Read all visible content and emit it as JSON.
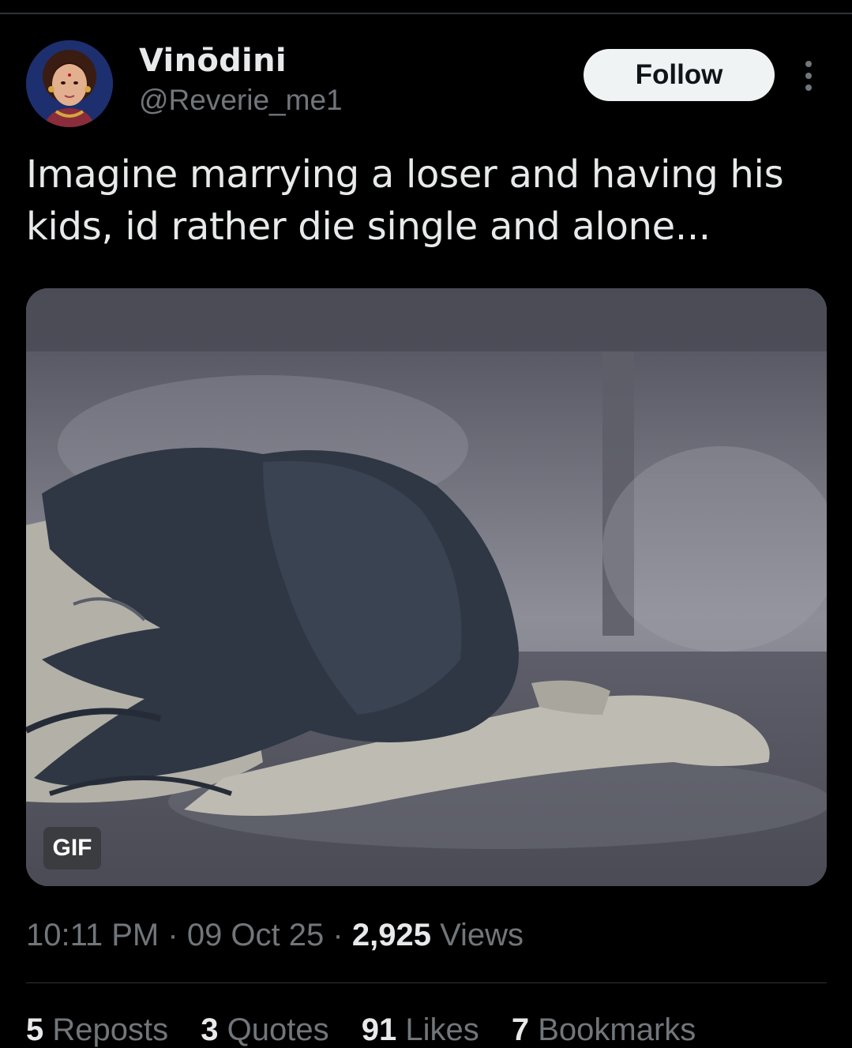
{
  "author": {
    "display_name": "Vinōdini",
    "handle": "@Reverie_me1",
    "avatar_icon": "profile-portrait-icon"
  },
  "actions": {
    "follow_label": "Follow",
    "more_icon": "more-vertical-icon"
  },
  "tweet": {
    "text_line1": "Imagine marrying a loser and having his",
    "text_line2": "kids, id rather die single and alone..."
  },
  "media": {
    "badge": "GIF"
  },
  "meta": {
    "time": "10:11 PM",
    "date": "09 Oct 25",
    "separator": "·",
    "views_count": "2,925",
    "views_label": "Views"
  },
  "stats": {
    "reposts_count": "5",
    "reposts_label": "Reposts",
    "quotes_count": "3",
    "quotes_label": "Quotes",
    "likes_count": "91",
    "likes_label": "Likes",
    "bookmarks_count": "7",
    "bookmarks_label": "Bookmarks"
  },
  "colors": {
    "background": "#000000",
    "primary_text": "#e7e9ea",
    "secondary_text": "#71767b",
    "follow_bg": "#eff3f4"
  }
}
